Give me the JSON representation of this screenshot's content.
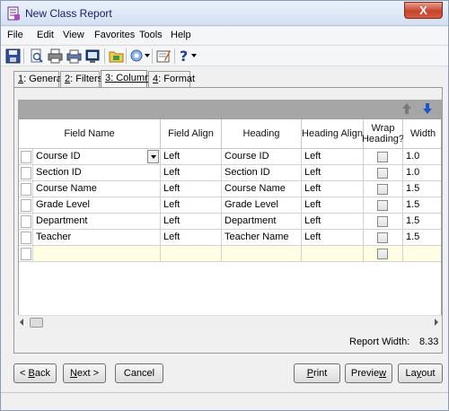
{
  "window": {
    "title": "New Class Report",
    "close_label": "X"
  },
  "menu": [
    "File",
    "Edit",
    "View",
    "Favorites",
    "Tools",
    "Help"
  ],
  "toolbar_icons": [
    "save-icon",
    "print-preview-icon",
    "print-icon",
    "print-setup-icon",
    "export-icon",
    "open-folder-icon",
    "settings-dropdown-icon",
    "properties-icon",
    "help-icon"
  ],
  "tabs": [
    {
      "key": "1",
      "label": ": General"
    },
    {
      "key": "2",
      "label": ": Filters"
    },
    {
      "key": "3",
      "label": ": Columns"
    },
    {
      "key": "4",
      "label": ": Format"
    }
  ],
  "grid": {
    "headers": [
      "Field Name",
      "Field Align",
      "Heading",
      "Heading Align",
      "Wrap Heading?",
      "Width"
    ],
    "rows": [
      {
        "field": "Course ID",
        "align": "Left",
        "heading": "Course ID",
        "heading_align": "Left",
        "width": "1.0"
      },
      {
        "field": "Section ID",
        "align": "Left",
        "heading": "Section ID",
        "heading_align": "Left",
        "width": "1.0"
      },
      {
        "field": "Course Name",
        "align": "Left",
        "heading": "Course Name",
        "heading_align": "Left",
        "width": "1.5"
      },
      {
        "field": "Grade Level",
        "align": "Left",
        "heading": "Grade Level",
        "heading_align": "Left",
        "width": "1.5"
      },
      {
        "field": "Department",
        "align": "Left",
        "heading": "Department",
        "heading_align": "Left",
        "width": "1.5"
      },
      {
        "field": "Teacher",
        "align": "Left",
        "heading": "Teacher Name",
        "heading_align": "Left",
        "width": "1.5"
      }
    ]
  },
  "report_width": {
    "label": "Report Width:",
    "value": "8.33"
  },
  "buttons": {
    "back_key": "B",
    "back_rest": "ack",
    "back_prefix": "< ",
    "next_key": "N",
    "next_rest": "ext >",
    "cancel": "Cancel",
    "print_key": "P",
    "print_rest": "rint",
    "preview_rest": "Previe",
    "preview_key": "w",
    "layout_rest": "La",
    "layout_key": "y",
    "layout_tail": "out"
  }
}
